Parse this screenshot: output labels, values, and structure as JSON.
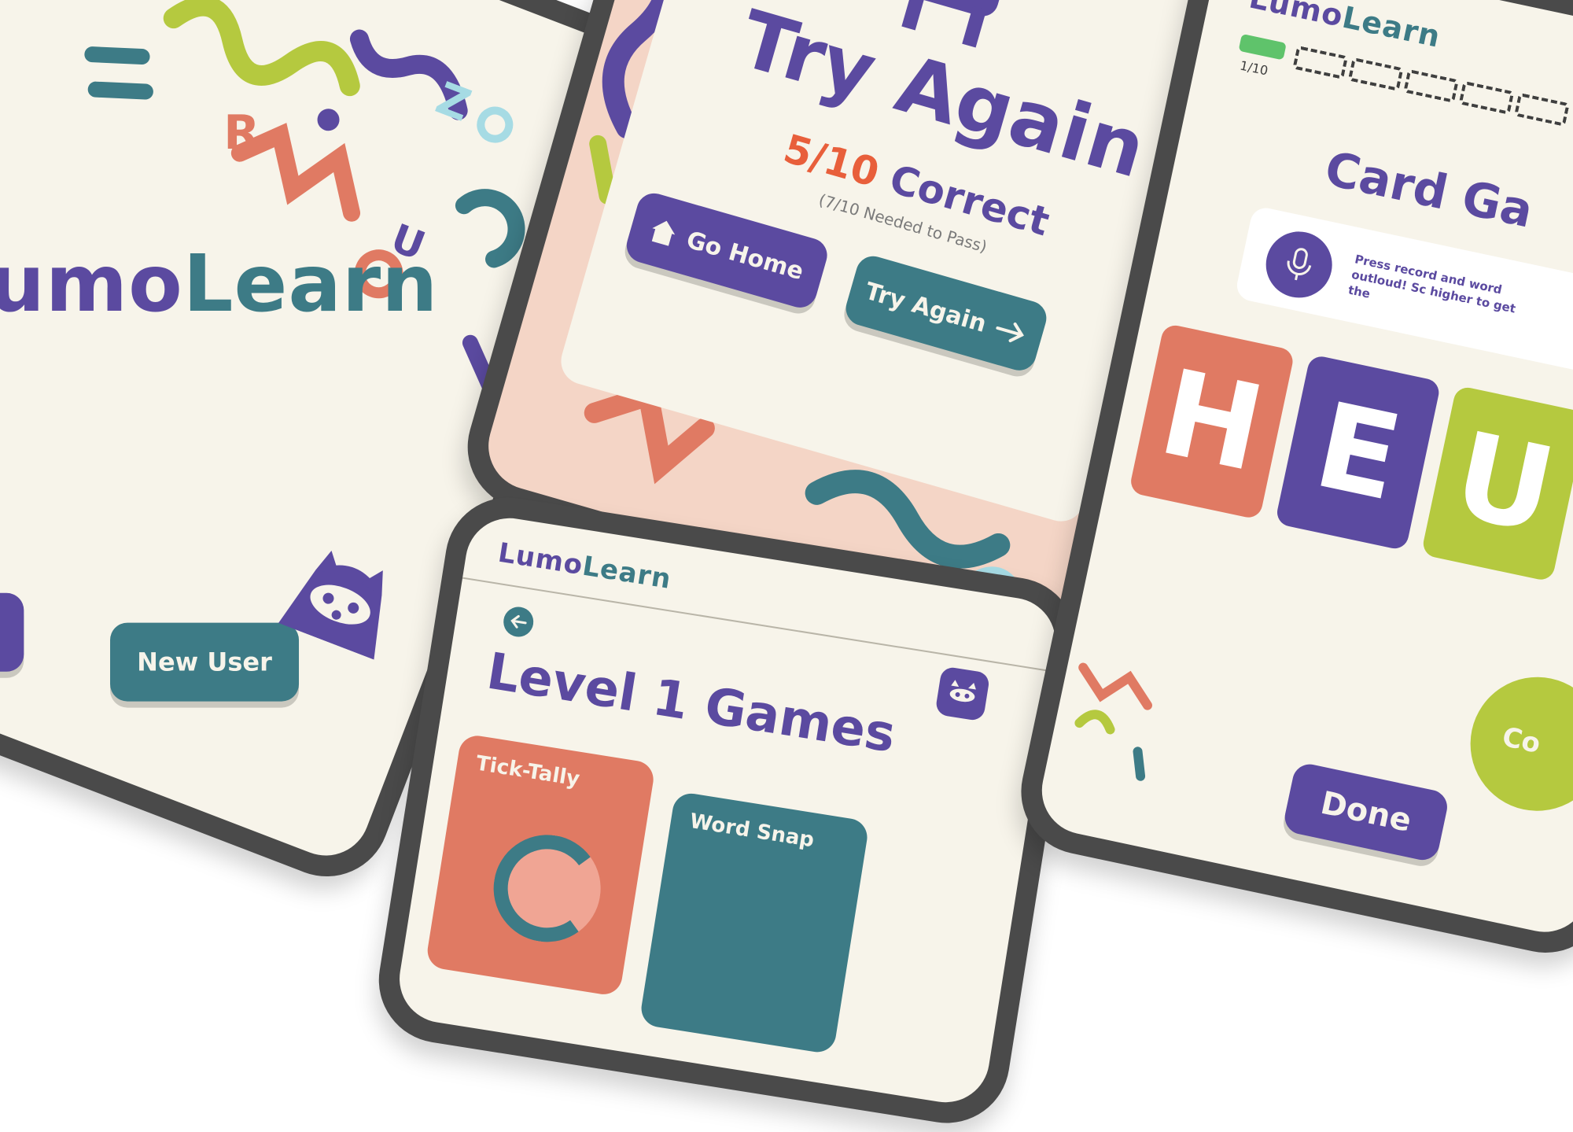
{
  "brand": {
    "part1": "Lumo",
    "part2": "Learn"
  },
  "welcome": {
    "logo_letters": [
      "R",
      "Z",
      "U",
      "C"
    ],
    "new_user_label": "New User",
    "icons": {
      "mascot": "raccoon-icon"
    }
  },
  "result": {
    "title": "Try Again",
    "score": "5/10",
    "score_suffix": "Correct",
    "needed": "(7/10 Needed to Pass)",
    "go_home_label": "Go Home",
    "try_again_label": "Try Again",
    "icons": {
      "home": "home-icon",
      "arrow": "arrow-right-icon",
      "mascot": "raccoon-icon",
      "badge": "star-badge-icon"
    }
  },
  "levels": {
    "title": "Level 1 Games",
    "games": [
      {
        "label": "Tick-Tally",
        "color": "#e07a63"
      },
      {
        "label": "Word Snap",
        "color": "#3d7b86"
      }
    ],
    "icons": {
      "back": "back-arrow-icon",
      "profile": "raccoon-icon"
    }
  },
  "cardgame": {
    "progress_text": "1/10",
    "progress_fill": 0.1,
    "title": "Card Ga",
    "instruction": "Press record and word outloud! Sc higher to get the",
    "letters": [
      "H",
      "E",
      "U"
    ],
    "badge_text": "Co",
    "done_label": "Done",
    "icons": {
      "mic": "microphone-icon",
      "badge": "star-badge-icon"
    }
  },
  "colors": {
    "purple": "#5b4aa0",
    "teal": "#3d7b86",
    "coral": "#e07a63",
    "lime": "#b5c93f",
    "cream": "#f7f4ea",
    "peach": "#f4d5c6"
  }
}
